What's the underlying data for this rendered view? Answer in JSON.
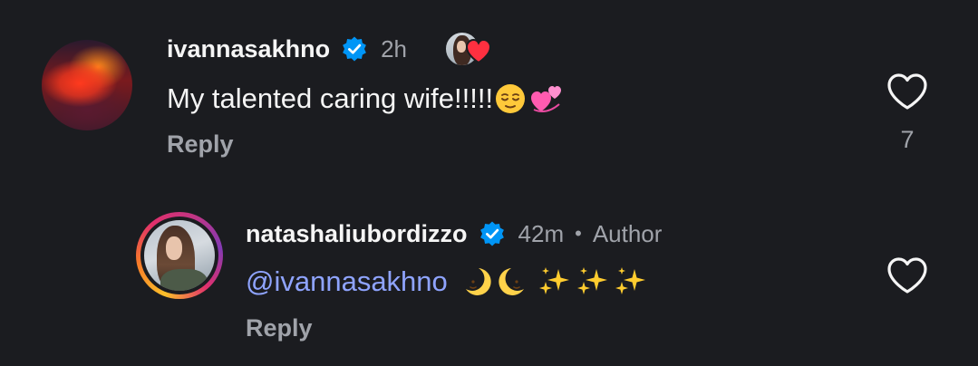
{
  "comments": [
    {
      "username": "ivannasakhno",
      "verified": true,
      "time": "2h",
      "text": "My talented caring wife!!!!!",
      "emojis": [
        "relieved-face",
        "revolving-hearts"
      ],
      "reply_label": "Reply",
      "like_count": "7",
      "liked_by_author": true
    },
    {
      "username": "natashaliubordizzo",
      "verified": true,
      "time": "42m",
      "separator": "•",
      "badge": "Author",
      "mention": "@ivannasakhno",
      "emojis": [
        "first-quarter-moon-face",
        "crescent-moon",
        "sparkles",
        "sparkles",
        "sparkles"
      ],
      "reply_label": "Reply"
    }
  ],
  "colors": {
    "background": "#1b1c20",
    "primary_text": "#f5f5f5",
    "secondary_text": "#a0a3aa",
    "mention": "#8fa4ff",
    "verified_blue": "#0095f6",
    "heart_red": "#ff3040"
  }
}
